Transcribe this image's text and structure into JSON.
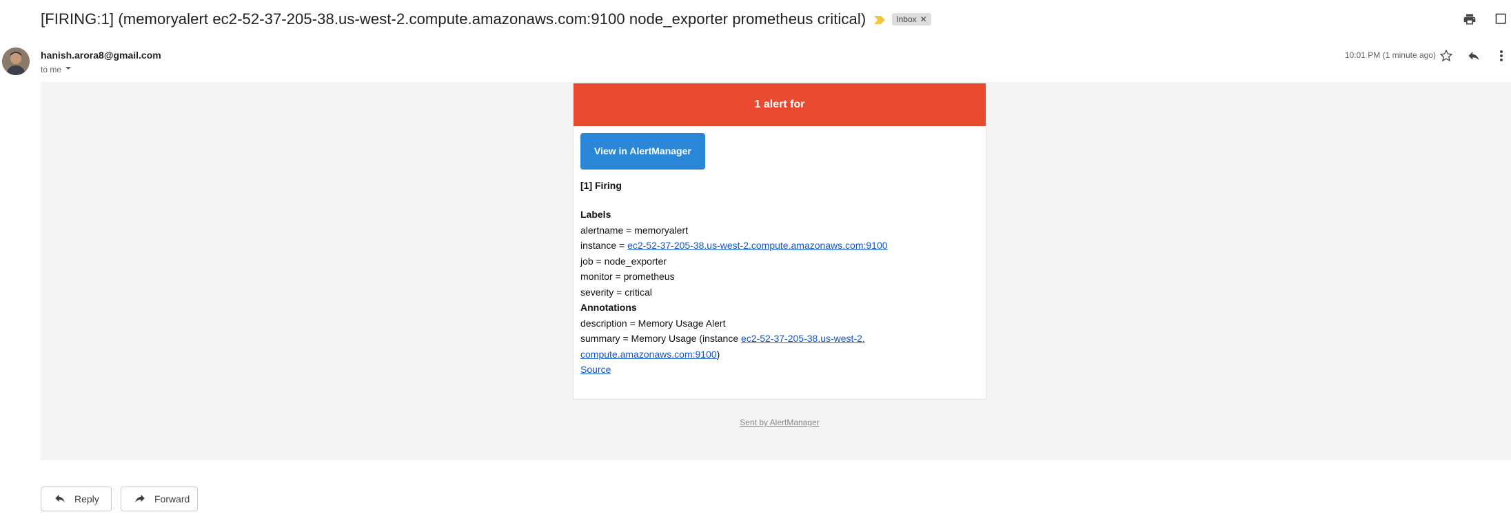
{
  "email": {
    "subject": "[FIRING:1] (memoryalert ec2-52-37-205-38.us-west-2.compute.amazonaws.com:9100 node_exporter prometheus critical)",
    "label_chip": "Inbox",
    "sender": "hanish.arora8@gmail.com",
    "to_line": "to me",
    "timestamp": "10:01 PM (1 minute ago)"
  },
  "alert": {
    "banner": "1 alert for",
    "button": "View in AlertManager",
    "firing_heading": "[1] Firing",
    "labels_heading": "Labels",
    "labels": [
      "alertname = memoryalert",
      "instance = ",
      "job = node_exporter",
      "monitor = prometheus",
      "severity = critical"
    ],
    "instance_link": "ec2-52-37-205-38.us-west-2.compute.amazonaws.com:9100",
    "annotations_heading": "Annotations",
    "description": "description = Memory Usage Alert",
    "summary_prefix": "summary = Memory Usage (instance ",
    "summary_link_line1": "ec2-52-37-205-38.us-west-2.",
    "summary_link_line2": "compute.amazonaws.com:9100",
    "summary_suffix": ")",
    "source_link": "Source",
    "footer": "Sent by AlertManager"
  },
  "actions": {
    "reply": "Reply",
    "forward": "Forward"
  },
  "colors": {
    "banner": "#e84a30",
    "button": "#2a87d7",
    "link": "#1155cc"
  },
  "icons": [
    "importance-marker-icon",
    "print-icon",
    "open-new-window-icon",
    "star-icon",
    "reply-icon",
    "more-icon",
    "chevron-down-icon",
    "forward-icon"
  ]
}
